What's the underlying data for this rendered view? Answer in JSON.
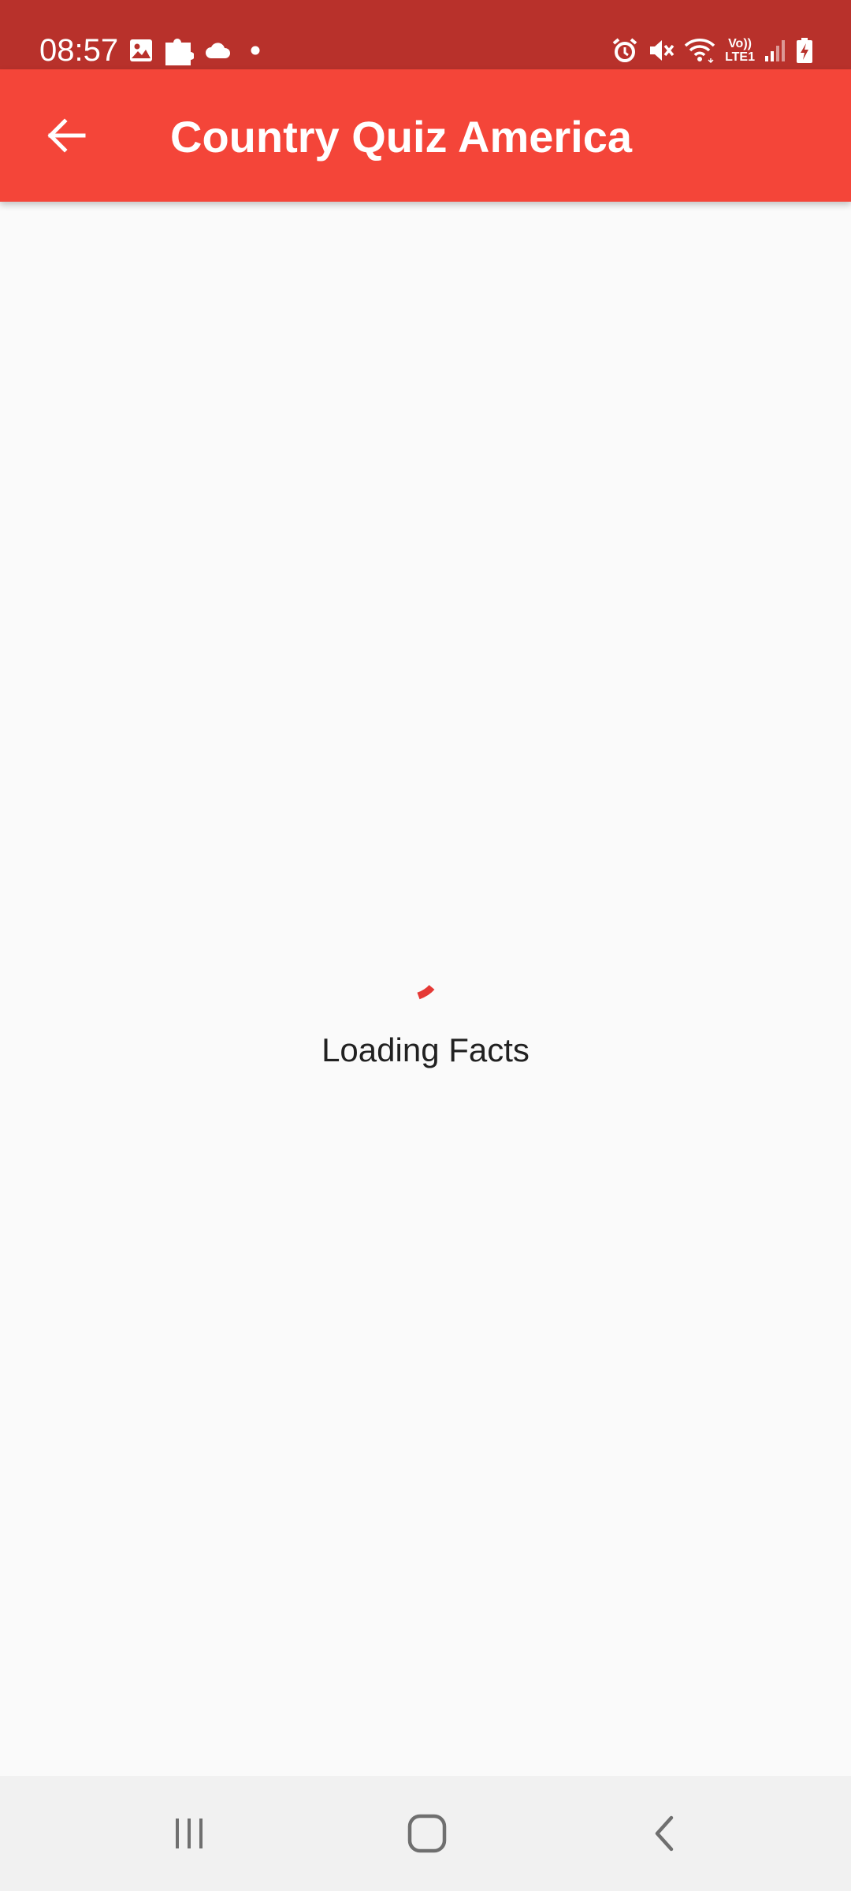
{
  "status_bar": {
    "time": "08:57",
    "lte_top": "Vo))",
    "lte_bottom": "LTE1",
    "background_color": "#b8312b",
    "left_icons": [
      "gallery-icon",
      "puzzle-icon",
      "cloud-icon",
      "notification-dot-icon"
    ],
    "right_icons": [
      "alarm-icon",
      "mute-icon",
      "wifi-icon",
      "signal-icon",
      "battery-charging-icon"
    ]
  },
  "app_bar": {
    "title": "Country Quiz America",
    "background_color": "#f44539",
    "back_icon": "arrow-back-icon"
  },
  "content": {
    "loading_text": "Loading Facts",
    "spinner_color": "#e53935"
  },
  "nav_bar": {
    "buttons": [
      "recent-apps-icon",
      "home-icon",
      "back-icon"
    ]
  }
}
